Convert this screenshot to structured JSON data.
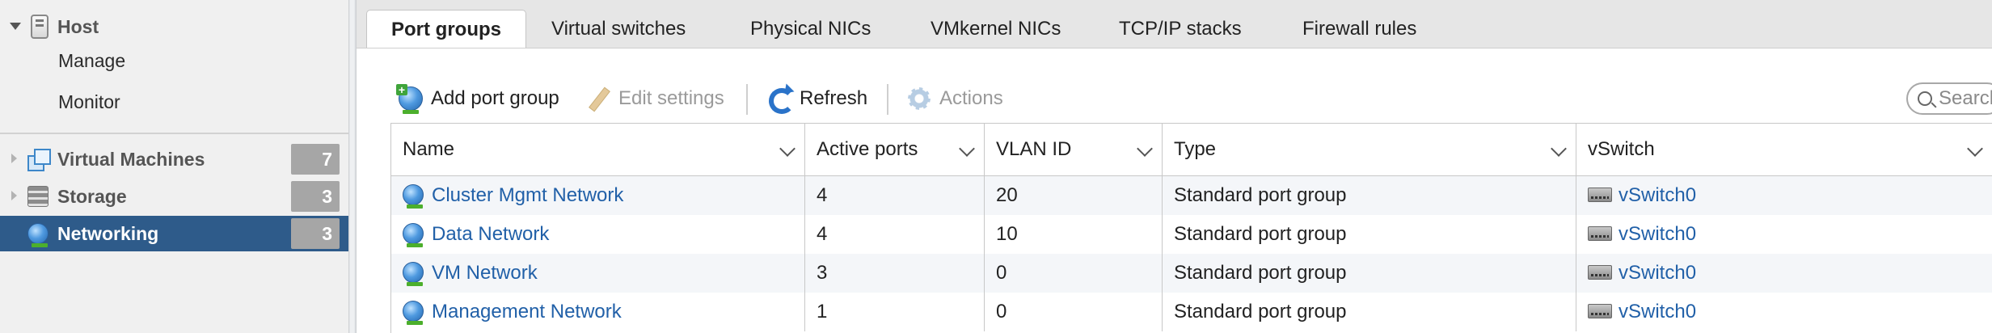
{
  "sidebar": {
    "host_label": "Host",
    "sub_items": [
      "Manage",
      "Monitor"
    ],
    "nav": [
      {
        "label": "Virtual Machines",
        "count": "7",
        "icon": "vm-icon"
      },
      {
        "label": "Storage",
        "count": "3",
        "icon": "storage-icon"
      },
      {
        "label": "Networking",
        "count": "3",
        "icon": "network-icon",
        "selected": true
      }
    ]
  },
  "tabs": [
    {
      "label": "Port groups",
      "active": true
    },
    {
      "label": "Virtual switches"
    },
    {
      "label": "Physical NICs"
    },
    {
      "label": "VMkernel NICs"
    },
    {
      "label": "TCP/IP stacks"
    },
    {
      "label": "Firewall rules"
    }
  ],
  "toolbar": {
    "add_port_group": "Add port group",
    "edit_settings": "Edit settings",
    "refresh": "Refresh",
    "actions": "Actions"
  },
  "search": {
    "placeholder": "Search"
  },
  "grid": {
    "columns": [
      "Name",
      "Active ports",
      "VLAN ID",
      "Type",
      "vSwitch"
    ],
    "rows": [
      {
        "name": "Cluster Mgmt Network",
        "active_ports": "4",
        "vlan_id": "20",
        "type": "Standard port group",
        "vswitch": "vSwitch0"
      },
      {
        "name": "Data Network",
        "active_ports": "4",
        "vlan_id": "10",
        "type": "Standard port group",
        "vswitch": "vSwitch0"
      },
      {
        "name": "VM Network",
        "active_ports": "3",
        "vlan_id": "0",
        "type": "Standard port group",
        "vswitch": "vSwitch0"
      },
      {
        "name": "Management Network",
        "active_ports": "1",
        "vlan_id": "0",
        "type": "Standard port group",
        "vswitch": "vSwitch0"
      }
    ]
  },
  "colors": {
    "selected_nav_bg": "#2e5b8a",
    "link": "#2160a8",
    "badge_bg": "#a6a6a6"
  }
}
